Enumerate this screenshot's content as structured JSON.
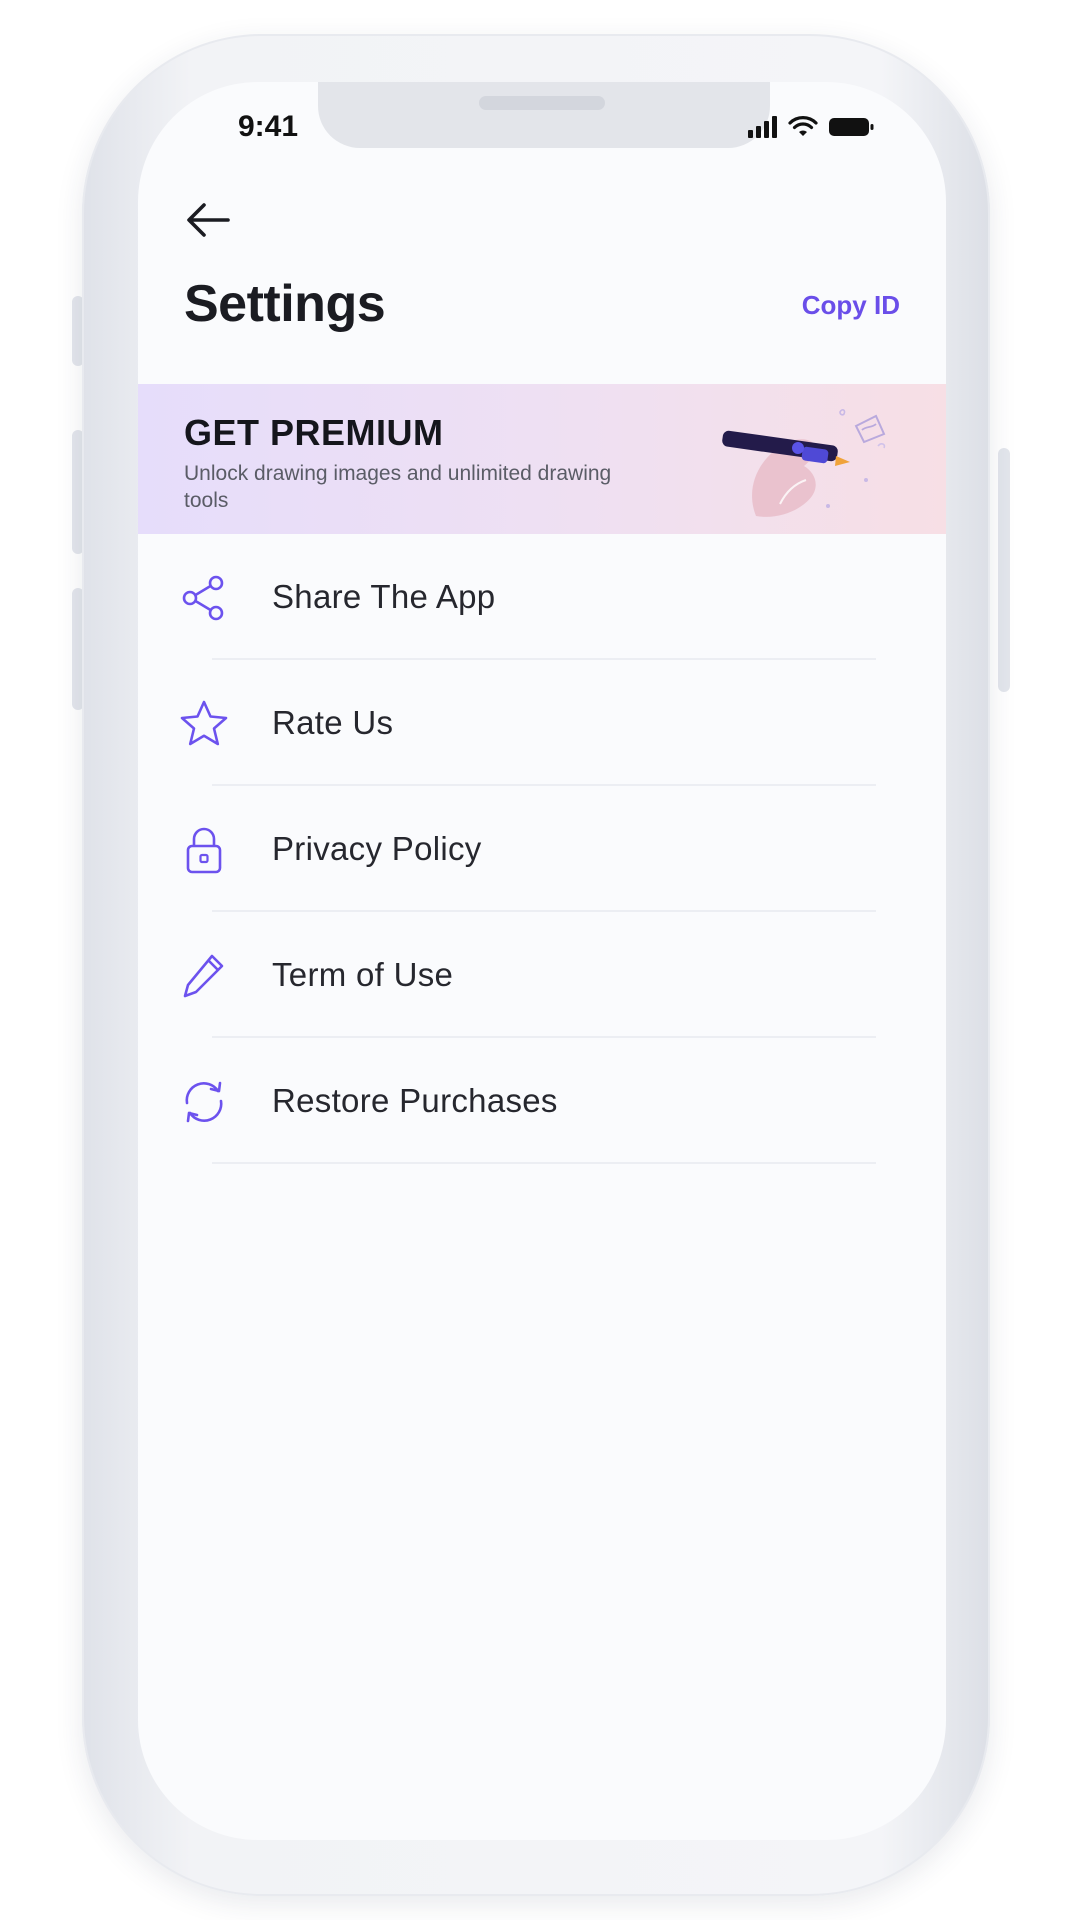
{
  "status_bar": {
    "time": "9:41"
  },
  "header": {
    "title": "Settings",
    "copy_id_label": "Copy ID"
  },
  "premium": {
    "title": "GET PREMIUM",
    "subtitle": "Unlock drawing images and unlimited drawing tools"
  },
  "menu": {
    "items": [
      {
        "label": "Share The App",
        "icon": "share-icon"
      },
      {
        "label": "Rate Us",
        "icon": "star-icon"
      },
      {
        "label": "Privacy Policy",
        "icon": "lock-icon"
      },
      {
        "label": "Term of Use",
        "icon": "pencil-icon"
      },
      {
        "label": "Restore Purchases",
        "icon": "refresh-icon"
      }
    ]
  },
  "colors": {
    "accent": "#6a4ee9",
    "icon": "#6c52ee",
    "background": "#fafbfd"
  }
}
